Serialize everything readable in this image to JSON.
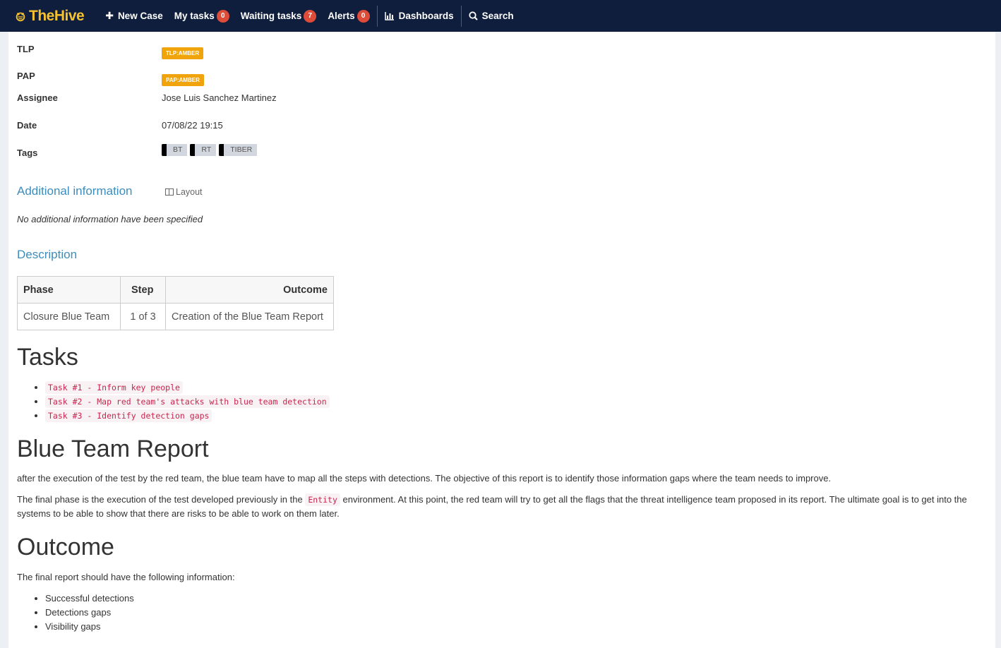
{
  "nav": {
    "brand_the": "The",
    "brand_hive": "Hive",
    "new_case": "New Case",
    "my_tasks": "My tasks",
    "my_tasks_count": "0",
    "waiting_tasks": "Waiting tasks",
    "waiting_tasks_count": "7",
    "alerts": "Alerts",
    "alerts_count": "0",
    "dashboards": "Dashboards",
    "search": "Search"
  },
  "details": {
    "tlp_label": "TLP",
    "tlp_value": "TLP:AMBER",
    "pap_label": "PAP",
    "pap_value": "PAP:AMBER",
    "assignee_label": "Assignee",
    "assignee_value": "Jose Luis Sanchez Martinez",
    "date_label": "Date",
    "date_value": "07/08/22 19:15",
    "tags_label": "Tags",
    "tags": [
      "BT",
      "RT",
      "TIBER"
    ]
  },
  "additional": {
    "title": "Additional information",
    "layout_label": "Layout",
    "note": "No additional information have been specified"
  },
  "description": {
    "title": "Description",
    "table": {
      "headers": [
        "Phase",
        "Step",
        "Outcome"
      ],
      "row": [
        "Closure Blue Team",
        "1 of 3",
        "Creation of the Blue Team Report"
      ]
    },
    "tasks_heading": "Tasks",
    "tasks": [
      "Task #1 - Inform key people",
      "Task #2 - Map red team's attacks with blue team detection",
      "Task #3 - Identify detection gaps"
    ],
    "report_heading": "Blue Team Report",
    "report_p1": "after the execution of the test by the red team, the blue team have to map all the steps with detections. The objective of this report is to identify those information gaps where the team needs to improve.",
    "report_p2_before": "The final phase is the execution of the test developed previously in the ",
    "report_p2_code": "Entity",
    "report_p2_after": " environment. At this point, the red team will try to get all the flags that the threat intelligence team proposed in its report. The ultimate goal is to get into the systems to be able to show that there are risks to be able to work on them later.",
    "outcome_heading": "Outcome",
    "outcome_intro": "The final report should have the following information:",
    "outcome_items": [
      "Successful detections",
      "Detections gaps",
      "Visibility gaps"
    ]
  }
}
